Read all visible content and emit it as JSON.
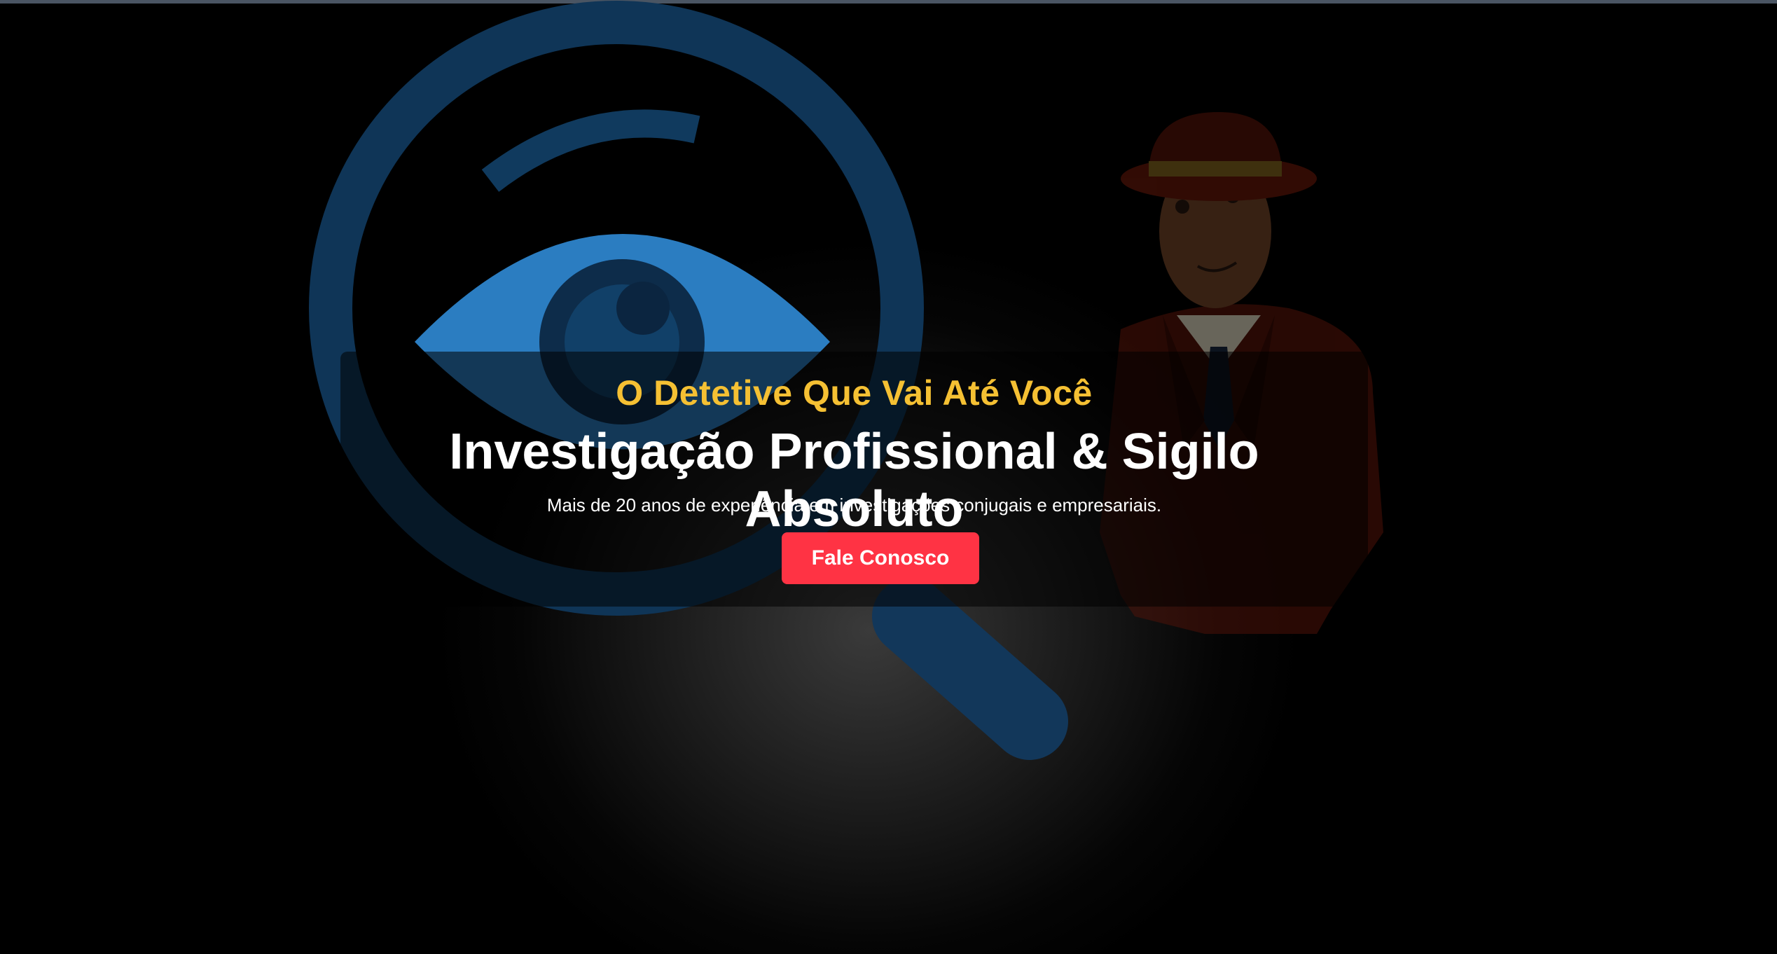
{
  "hero": {
    "tagline": "O Detetive Que Vai Até Você",
    "headline": "Investigação Profissional & Sigilo Absoluto",
    "subtext": "Mais de 20 anos de experiência em investigações conjugais e empresariais.",
    "cta_label": "Fale Conosco"
  },
  "background": {
    "icons": [
      "magnifying-glass-eye-icon",
      "detective-illustration"
    ]
  },
  "colors": {
    "accent_yellow": "#f5c033",
    "cta_red": "#ff3344",
    "icon_blue": "#2b7dc1",
    "icon_dark_blue": "#0f3557",
    "background": "#000000"
  }
}
